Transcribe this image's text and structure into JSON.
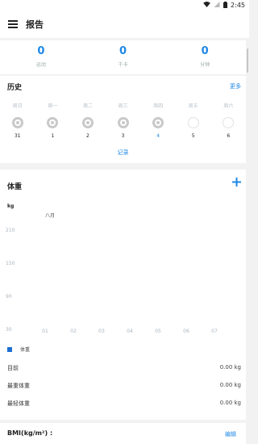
{
  "status_bar": {
    "time": "2:45"
  },
  "app_bar": {
    "title": "报告"
  },
  "stats": [
    {
      "value": "0",
      "label": "运动"
    },
    {
      "value": "0",
      "label": "千卡"
    },
    {
      "value": "0",
      "label": "分钟"
    }
  ],
  "history": {
    "title": "历史",
    "more": "更多",
    "days": [
      {
        "weekday": "周日",
        "date": "31",
        "state": "filled",
        "today": false
      },
      {
        "weekday": "周一",
        "date": "1",
        "state": "filled",
        "today": false
      },
      {
        "weekday": "周二",
        "date": "2",
        "state": "filled",
        "today": false
      },
      {
        "weekday": "周三",
        "date": "3",
        "state": "filled",
        "today": false
      },
      {
        "weekday": "周四",
        "date": "4",
        "state": "filled",
        "today": true
      },
      {
        "weekday": "周五",
        "date": "5",
        "state": "empty",
        "today": false
      },
      {
        "weekday": "周六",
        "date": "6",
        "state": "empty",
        "today": false
      }
    ],
    "record": "记录"
  },
  "weight": {
    "title": "体重",
    "add_icon": "plus-icon",
    "current_label": "目前",
    "current_value": "0.00 kg",
    "heaviest_label": "最重体重",
    "heaviest_value": "0.00 kg",
    "lightest_label": "最轻体重",
    "lightest_value": "0.00 kg"
  },
  "chart_data": {
    "type": "line",
    "ylabel": "kg",
    "month_label": "八月",
    "y_ticks": [
      "210",
      "150",
      "90",
      "30"
    ],
    "ylim": [
      30,
      210
    ],
    "categories": [
      "01",
      "02",
      "03",
      "04",
      "05",
      "06",
      "07"
    ],
    "series": [
      {
        "name": "体重",
        "values": [],
        "color": "#1e6fd0"
      }
    ],
    "grid": false,
    "legend": "bottom-left"
  },
  "bmi": {
    "title": "BMI(kg/m²) :",
    "edit": "编辑"
  },
  "colors": {
    "accent": "#1e88e5",
    "legend": "#1e6fd0"
  }
}
